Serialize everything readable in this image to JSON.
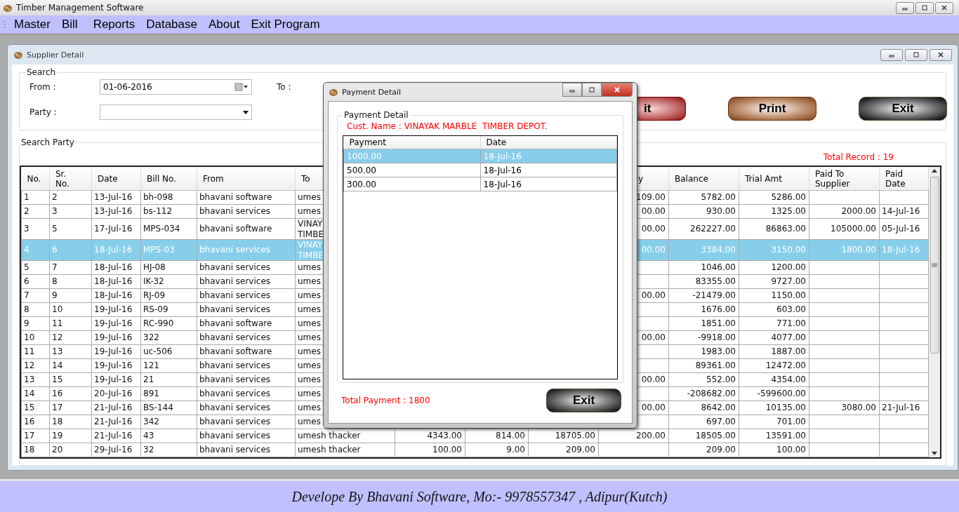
{
  "window": {
    "title": "Timber Management Software"
  },
  "menu": [
    "Master",
    "Bill",
    "Reports",
    "Database",
    "About",
    "Exit Program"
  ],
  "child_window": {
    "title": "Supplier Detail",
    "search": {
      "legend": "Search",
      "from_label": "From :",
      "from_value": "01-06-2016",
      "to_label": "To :",
      "party_label": "Party :"
    },
    "buttons": [
      {
        "label": "it",
        "kind": "edit"
      },
      {
        "label": "Print",
        "kind": "print"
      },
      {
        "label": "Exit",
        "kind": "exit"
      }
    ],
    "results": {
      "legend": "Search Party",
      "total_record": "Total Record : 19",
      "columns": [
        "No.",
        "Sr.\nNo.",
        "Date",
        "Bill No.",
        "From",
        "To",
        null,
        null,
        null,
        "y",
        "Balance",
        "Trial Amt",
        "Paid To\nSupplier",
        "Paid\nDate"
      ],
      "rows": [
        {
          "selected": false,
          "cells": [
            "1",
            "2",
            "13-Jul-16",
            "bh-098",
            "bhavani software",
            "umes",
            null,
            null,
            null,
            "109.00",
            "5782.00",
            "5286.00",
            null,
            null
          ]
        },
        {
          "selected": false,
          "cells": [
            "2",
            "3",
            "13-Jul-16",
            "bs-112",
            "bhavani services",
            "umes",
            null,
            null,
            null,
            "00.00",
            "930.00",
            "1325.00",
            "2000.00",
            "14-Jul-16"
          ]
        },
        {
          "selected": false,
          "cells": [
            "3",
            "5",
            "17-Jul-16",
            "MPS-034",
            "bhavani software",
            "VINAY\nTIMBE",
            null,
            null,
            null,
            "00.00",
            "262227.00",
            "86863.00",
            "105000.00",
            "05-Jul-16"
          ]
        },
        {
          "selected": true,
          "cells": [
            "4",
            "6",
            "18-Jul-16",
            "MPS-03",
            "bhavani services",
            "VINAY\nTIMBE",
            null,
            null,
            null,
            "00.00",
            "3384.00",
            "3150.00",
            "1800.00",
            "18-Jul-16"
          ]
        },
        {
          "selected": false,
          "cells": [
            "5",
            "7",
            "18-Jul-16",
            "HJ-08",
            "bhavani services",
            "umes",
            null,
            null,
            null,
            null,
            "1046.00",
            "1200.00",
            null,
            null
          ]
        },
        {
          "selected": false,
          "cells": [
            "6",
            "8",
            "18-Jul-16",
            "IK-32",
            "bhavani services",
            "umes",
            null,
            null,
            null,
            null,
            "83355.00",
            "9727.00",
            null,
            null
          ]
        },
        {
          "selected": false,
          "cells": [
            "7",
            "9",
            "18-Jul-16",
            "RJ-09",
            "bhavani services",
            "umes",
            null,
            null,
            null,
            "00.00",
            "-21479.00",
            "1150.00",
            null,
            null
          ]
        },
        {
          "selected": false,
          "cells": [
            "8",
            "10",
            "19-Jul-16",
            "RS-09",
            "bhavani services",
            "umes",
            null,
            null,
            null,
            null,
            "1676.00",
            "603.00",
            null,
            null
          ]
        },
        {
          "selected": false,
          "cells": [
            "9",
            "11",
            "19-Jul-16",
            "RC-990",
            "bhavani software",
            "umes",
            null,
            null,
            null,
            null,
            "1851.00",
            "771.00",
            null,
            null
          ]
        },
        {
          "selected": false,
          "cells": [
            "10",
            "12",
            "19-Jul-16",
            "322",
            "bhavani services",
            "umes",
            null,
            null,
            null,
            "00.00",
            "-9918.00",
            "4077.00",
            null,
            null
          ]
        },
        {
          "selected": false,
          "cells": [
            "11",
            "13",
            "19-Jul-16",
            "uc-506",
            "bhavani software",
            "umes",
            null,
            null,
            null,
            null,
            "1983.00",
            "1887.00",
            null,
            null
          ]
        },
        {
          "selected": false,
          "cells": [
            "12",
            "14",
            "19-Jul-16",
            "121",
            "bhavani services",
            "umes",
            null,
            null,
            null,
            null,
            "89361.00",
            "12472.00",
            null,
            null
          ]
        },
        {
          "selected": false,
          "cells": [
            "13",
            "15",
            "19-Jul-16",
            "21",
            "bhavani services",
            "umes",
            null,
            null,
            null,
            "00.00",
            "552.00",
            "4354.00",
            null,
            null
          ]
        },
        {
          "selected": false,
          "cells": [
            "14",
            "16",
            "20-Jul-16",
            "891",
            "bhavani services",
            "umes",
            null,
            null,
            null,
            null,
            "-208682.00",
            "-599600.00",
            null,
            null
          ]
        },
        {
          "selected": false,
          "cells": [
            "15",
            "17",
            "21-Jul-16",
            "BS-144",
            "bhavani services",
            "umes",
            null,
            null,
            null,
            "00.00",
            "8642.00",
            "10135.00",
            "3080.00",
            "21-Jul-16"
          ]
        },
        {
          "selected": false,
          "cells": [
            "16",
            "18",
            "21-Jul-16",
            "342",
            "bhavani services",
            "umes",
            null,
            null,
            null,
            null,
            "697.00",
            "701.00",
            null,
            null
          ]
        },
        {
          "selected": false,
          "cells": [
            "17",
            "19",
            "21-Jul-16",
            "43",
            "bhavani services",
            "umesh thacker",
            "4343.00",
            "814.00",
            "18705.00",
            "200.00",
            "18505.00",
            "13591.00",
            null,
            null
          ]
        },
        {
          "selected": false,
          "cells": [
            "18",
            "20",
            "29-Jul-16",
            "32",
            "bhavani services",
            "umesh thacker",
            "100.00",
            "9.00",
            "209.00",
            null,
            "209.00",
            "100.00",
            null,
            null
          ]
        }
      ]
    }
  },
  "dialog": {
    "title": "Payment Detail",
    "legend": "Payment Detail",
    "customer": "Cust. Name : VINAYAK MARBLE  TIMBER DEPOT.",
    "columns": [
      "Payment",
      "Date"
    ],
    "rows": [
      {
        "selected": true,
        "cells": [
          "1000.00",
          "18-Jul-16"
        ]
      },
      {
        "selected": false,
        "cells": [
          "500.00",
          "18-Jul-16"
        ]
      },
      {
        "selected": false,
        "cells": [
          "300.00",
          "18-Jul-16"
        ]
      }
    ],
    "total": "Total Payment : 1800",
    "button": "Exit"
  },
  "footer": "Develope By Bhavani Software, Mo:- 9978557347 , Adipur(Kutch)"
}
